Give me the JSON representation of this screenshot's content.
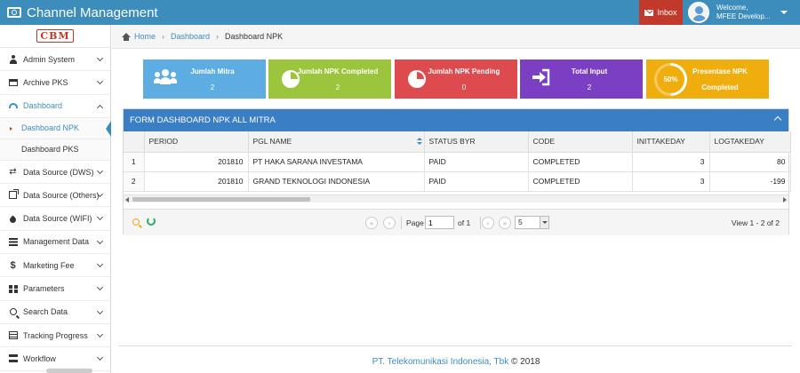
{
  "app": {
    "title": "Channel Management"
  },
  "header": {
    "inbox_label": "Inbox",
    "welcome": "Welcome,",
    "user_name": "MFEE Develop..."
  },
  "sidebar": {
    "logo_text": "CBM",
    "items": [
      {
        "label": "Admin System",
        "icon": "user-icon"
      },
      {
        "label": "Archive PKS",
        "icon": "archive-icon"
      },
      {
        "label": "Dashboard",
        "icon": "dashboard-icon",
        "expanded": true,
        "children": [
          {
            "label": "Dashboard NPK",
            "current": true
          },
          {
            "label": "Dashboard PKS"
          }
        ]
      },
      {
        "label": "Data Source (DWS)",
        "icon": "exchange-icon"
      },
      {
        "label": "Data Source (Others)",
        "icon": "external-link-icon"
      },
      {
        "label": "Data Source (WIFI)",
        "icon": "fire-icon"
      },
      {
        "label": "Management Data",
        "icon": "list-icon"
      },
      {
        "label": "Marketing Fee",
        "icon": "dollar-icon"
      },
      {
        "label": "Parameters",
        "icon": "grid-icon"
      },
      {
        "label": "Search Data",
        "icon": "search-icon"
      },
      {
        "label": "Tracking Progress",
        "icon": "tasks-icon"
      },
      {
        "label": "Workflow",
        "icon": "workflow-icon"
      }
    ]
  },
  "breadcrumb": {
    "home": "Home",
    "parent": "Dashboard",
    "current": "Dashboard NPK"
  },
  "stats": [
    {
      "label": "Jumlah Mitra",
      "value": "2",
      "color": "#5dade2",
      "icon": "users-icon"
    },
    {
      "label": "Jumlah NPK Completed",
      "value": "2",
      "color": "#9bc53d",
      "icon": "pie-chart-icon"
    },
    {
      "label": "Jumlah NPK Pending",
      "value": "0",
      "color": "#dd4b4f",
      "icon": "pie-chart-icon"
    },
    {
      "label": "Total Input",
      "value": "2",
      "color": "#7b3fc4",
      "icon": "sign-in-icon"
    },
    {
      "label": "Presentase NPK",
      "value": "Completed",
      "percent": "50%",
      "color": "#f0ad0e",
      "icon": "progress-circle"
    }
  ],
  "panel": {
    "title": "FORM DASHBOARD NPK ALL MITRA",
    "columns": [
      "",
      "PERIOD",
      "PGL NAME",
      "STATUS BYR",
      "CODE",
      "INITTAKEDAY",
      "LOGTAKEDAY"
    ],
    "rows": [
      {
        "no": "1",
        "period": "201810",
        "pgl_name": "PT HAKA SARANA INVESTAMA",
        "status_byr": "PAID",
        "code": "COMPLETED",
        "inittakeday": "3",
        "logtakeday": "80"
      },
      {
        "no": "2",
        "period": "201810",
        "pgl_name": "GRAND TEKNOLOGI INDONESIA",
        "status_byr": "PAID",
        "code": "COMPLETED",
        "inittakeday": "3",
        "logtakeday": "-199"
      }
    ],
    "pager": {
      "page_label": "Page",
      "page_value": "1",
      "of_label": "of 1",
      "rows_per_page": "5",
      "view_text": "View 1 - 2 of 2"
    }
  },
  "footer": {
    "company": "PT. Telekomunikasi Indonesia, Tbk",
    "suffix": " © 2018"
  }
}
